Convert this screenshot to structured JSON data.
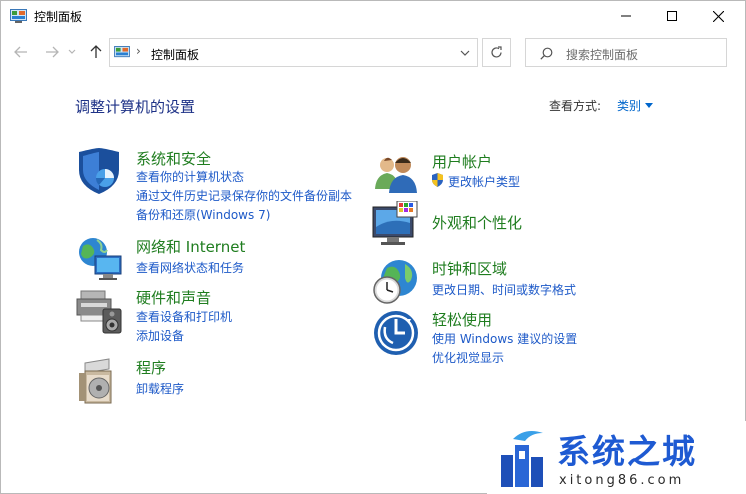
{
  "window": {
    "title": "控制面板"
  },
  "address": {
    "path": "控制面板",
    "separator": "›"
  },
  "search": {
    "placeholder": "搜索控制面板"
  },
  "content": {
    "heading": "调整计算机的设置",
    "view_by_label": "查看方式:",
    "view_by_value": "类别"
  },
  "categories": [
    {
      "title": "系统和安全",
      "icon": "system-security-icon",
      "links": [
        "查看你的计算机状态",
        "通过文件历史记录保存你的文件备份副本",
        "备份和还原(Windows 7)"
      ]
    },
    {
      "title": "网络和 Internet",
      "icon": "network-icon",
      "links": [
        "查看网络状态和任务"
      ]
    },
    {
      "title": "硬件和声音",
      "icon": "hardware-sound-icon",
      "links": [
        "查看设备和打印机",
        "添加设备"
      ]
    },
    {
      "title": "程序",
      "icon": "programs-icon",
      "links": [
        "卸载程序"
      ]
    },
    {
      "title": "用户帐户",
      "icon": "user-accounts-icon",
      "links": [
        "更改帐户类型"
      ]
    },
    {
      "title": "外观和个性化",
      "icon": "appearance-icon",
      "links": []
    },
    {
      "title": "时钟和区域",
      "icon": "clock-region-icon",
      "links": [
        "更改日期、时间或数字格式"
      ]
    },
    {
      "title": "轻松使用",
      "icon": "ease-of-access-icon",
      "links": [
        "使用 Windows 建议的设置",
        "优化视觉显示"
      ]
    }
  ],
  "watermark": {
    "text": "系统之城",
    "subtext": "xitong86.com"
  },
  "colors": {
    "heading": "#1e3287",
    "category": "#1f7d1f",
    "link": "#1e5ac8"
  }
}
